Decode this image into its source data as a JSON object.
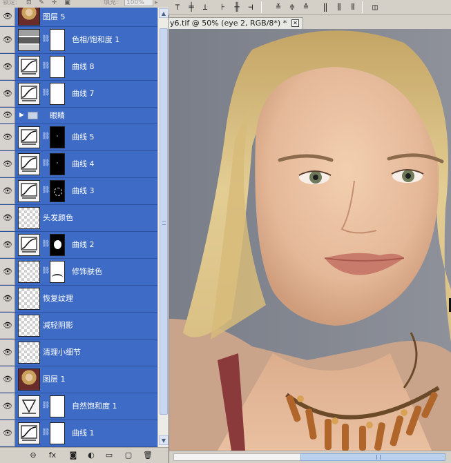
{
  "layers_panel": {
    "lock_label": "锁定:",
    "lock_icons": "⊡ ✎ ✛ ▣",
    "fill_label": "填充:",
    "fill_value": "100%",
    "fill_arrow": "▸",
    "scroll_up": "▲",
    "scroll_down": "▼",
    "bottom_buttons": [
      {
        "icon": "link-layers-icon",
        "glyph": "⊖"
      },
      {
        "icon": "fx-icon",
        "glyph": "fx"
      },
      {
        "icon": "add-mask-icon",
        "glyph": "◙"
      },
      {
        "icon": "adjustment-layer-icon",
        "glyph": "◐"
      },
      {
        "icon": "new-group-icon",
        "glyph": "▭"
      },
      {
        "icon": "new-layer-icon",
        "glyph": "▢"
      },
      {
        "icon": "delete-layer-icon",
        "glyph": "🗑"
      }
    ],
    "layers": [
      {
        "name": "图层 5",
        "kind": "photo",
        "visible": true
      },
      {
        "name": "色相/饱和度 1",
        "kind": "hue",
        "mask": "white",
        "visible": true
      },
      {
        "name": "曲线 8",
        "kind": "curves",
        "mask": "white",
        "visible": true
      },
      {
        "name": "曲线 7",
        "kind": "curves",
        "mask": "white",
        "visible": true
      },
      {
        "name": "眼睛",
        "kind": "group",
        "visible": true
      },
      {
        "name": "曲线 5",
        "kind": "curves",
        "mask": "black-dots",
        "visible": true
      },
      {
        "name": "曲线 4",
        "kind": "curves",
        "mask": "black-dots",
        "visible": true
      },
      {
        "name": "曲线 3",
        "kind": "curves",
        "mask": "black-ring",
        "visible": true
      },
      {
        "name": "头发颜色",
        "kind": "checker",
        "visible": true
      },
      {
        "name": "曲线 2",
        "kind": "curves",
        "mask": "black-blob",
        "visible": true
      },
      {
        "name": "修饰肤色",
        "kind": "checker",
        "mask": "skin",
        "visible": true
      },
      {
        "name": "恢复纹理",
        "kind": "checker",
        "visible": true
      },
      {
        "name": "减轻阴影",
        "kind": "checker",
        "visible": true
      },
      {
        "name": "清理小细节",
        "kind": "checker",
        "visible": true
      },
      {
        "name": "图层 1",
        "kind": "photo",
        "visible": true
      },
      {
        "name": "自然饱和度 1",
        "kind": "vibrance",
        "mask": "white",
        "visible": true
      },
      {
        "name": "曲线 1",
        "kind": "curves",
        "mask": "white",
        "visible": true
      }
    ]
  },
  "options_bar": {
    "icons": [
      {
        "name": "align-top-edges-icon",
        "glyph": "⊤"
      },
      {
        "name": "align-vertical-centers-icon",
        "glyph": "╪"
      },
      {
        "name": "align-bottom-edges-icon",
        "glyph": "⊥"
      },
      {
        "name": "align-left-edges-icon",
        "glyph": "⊦"
      },
      {
        "name": "align-horizontal-centers-icon",
        "glyph": "╫"
      },
      {
        "name": "align-right-edges-icon",
        "glyph": "⊣"
      },
      {
        "name": "distribute-top-icon",
        "glyph": "≚"
      },
      {
        "name": "distribute-vcenter-icon",
        "glyph": "≑"
      },
      {
        "name": "distribute-bottom-icon",
        "glyph": "≙"
      },
      {
        "name": "distribute-left-icon",
        "glyph": "‖"
      },
      {
        "name": "distribute-hcenter-icon",
        "glyph": "⫼"
      },
      {
        "name": "distribute-right-icon",
        "glyph": "⫴"
      },
      {
        "name": "auto-align-icon",
        "glyph": "◫"
      }
    ]
  },
  "document": {
    "tab_title": "y6.tif @ 50% (eye 2, RGB/8*) *",
    "close_glyph": "✕"
  }
}
